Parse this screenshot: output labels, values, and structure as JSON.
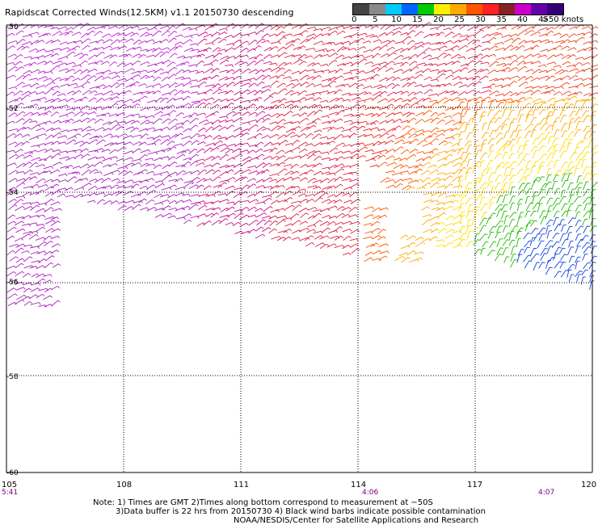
{
  "title": "Rapidscat Corrected Winds(12.5KM) v1.1 20150730 descending",
  "legend": {
    "colors": [
      "#444444",
      "#8a8a8a",
      "#00ccff",
      "#0066ff",
      "#00cc00",
      "#ffee00",
      "#ffaa00",
      "#ff5500",
      "#ff2222",
      "#882222",
      "#cc00cc",
      "#6600aa",
      "#330077"
    ],
    "ticks": [
      "0",
      "5",
      "10",
      "15",
      "20",
      "25",
      "30",
      "35",
      "40",
      "45",
      ">50 knots"
    ]
  },
  "map": {
    "lat_labels": [
      "-50",
      "-52",
      "-54",
      "-56",
      "-58",
      "-60"
    ],
    "lon_labels": [
      "105",
      "108",
      "111",
      "114",
      "117",
      "120"
    ],
    "times": [
      "5:41",
      "4:06",
      "4:07"
    ],
    "colors": {
      "grid": "#000000",
      "time": "#800080"
    }
  },
  "notes": [
    "Note: 1) Times are GMT 2)Times along bottom correspond to measurement at −50S",
    "3)Data buffer is 22 hrs from 20150730 4) Black wind barbs indicate possible contamination",
    "NOAA/NESDIS/Center for Satellite Applications and Research"
  ]
}
